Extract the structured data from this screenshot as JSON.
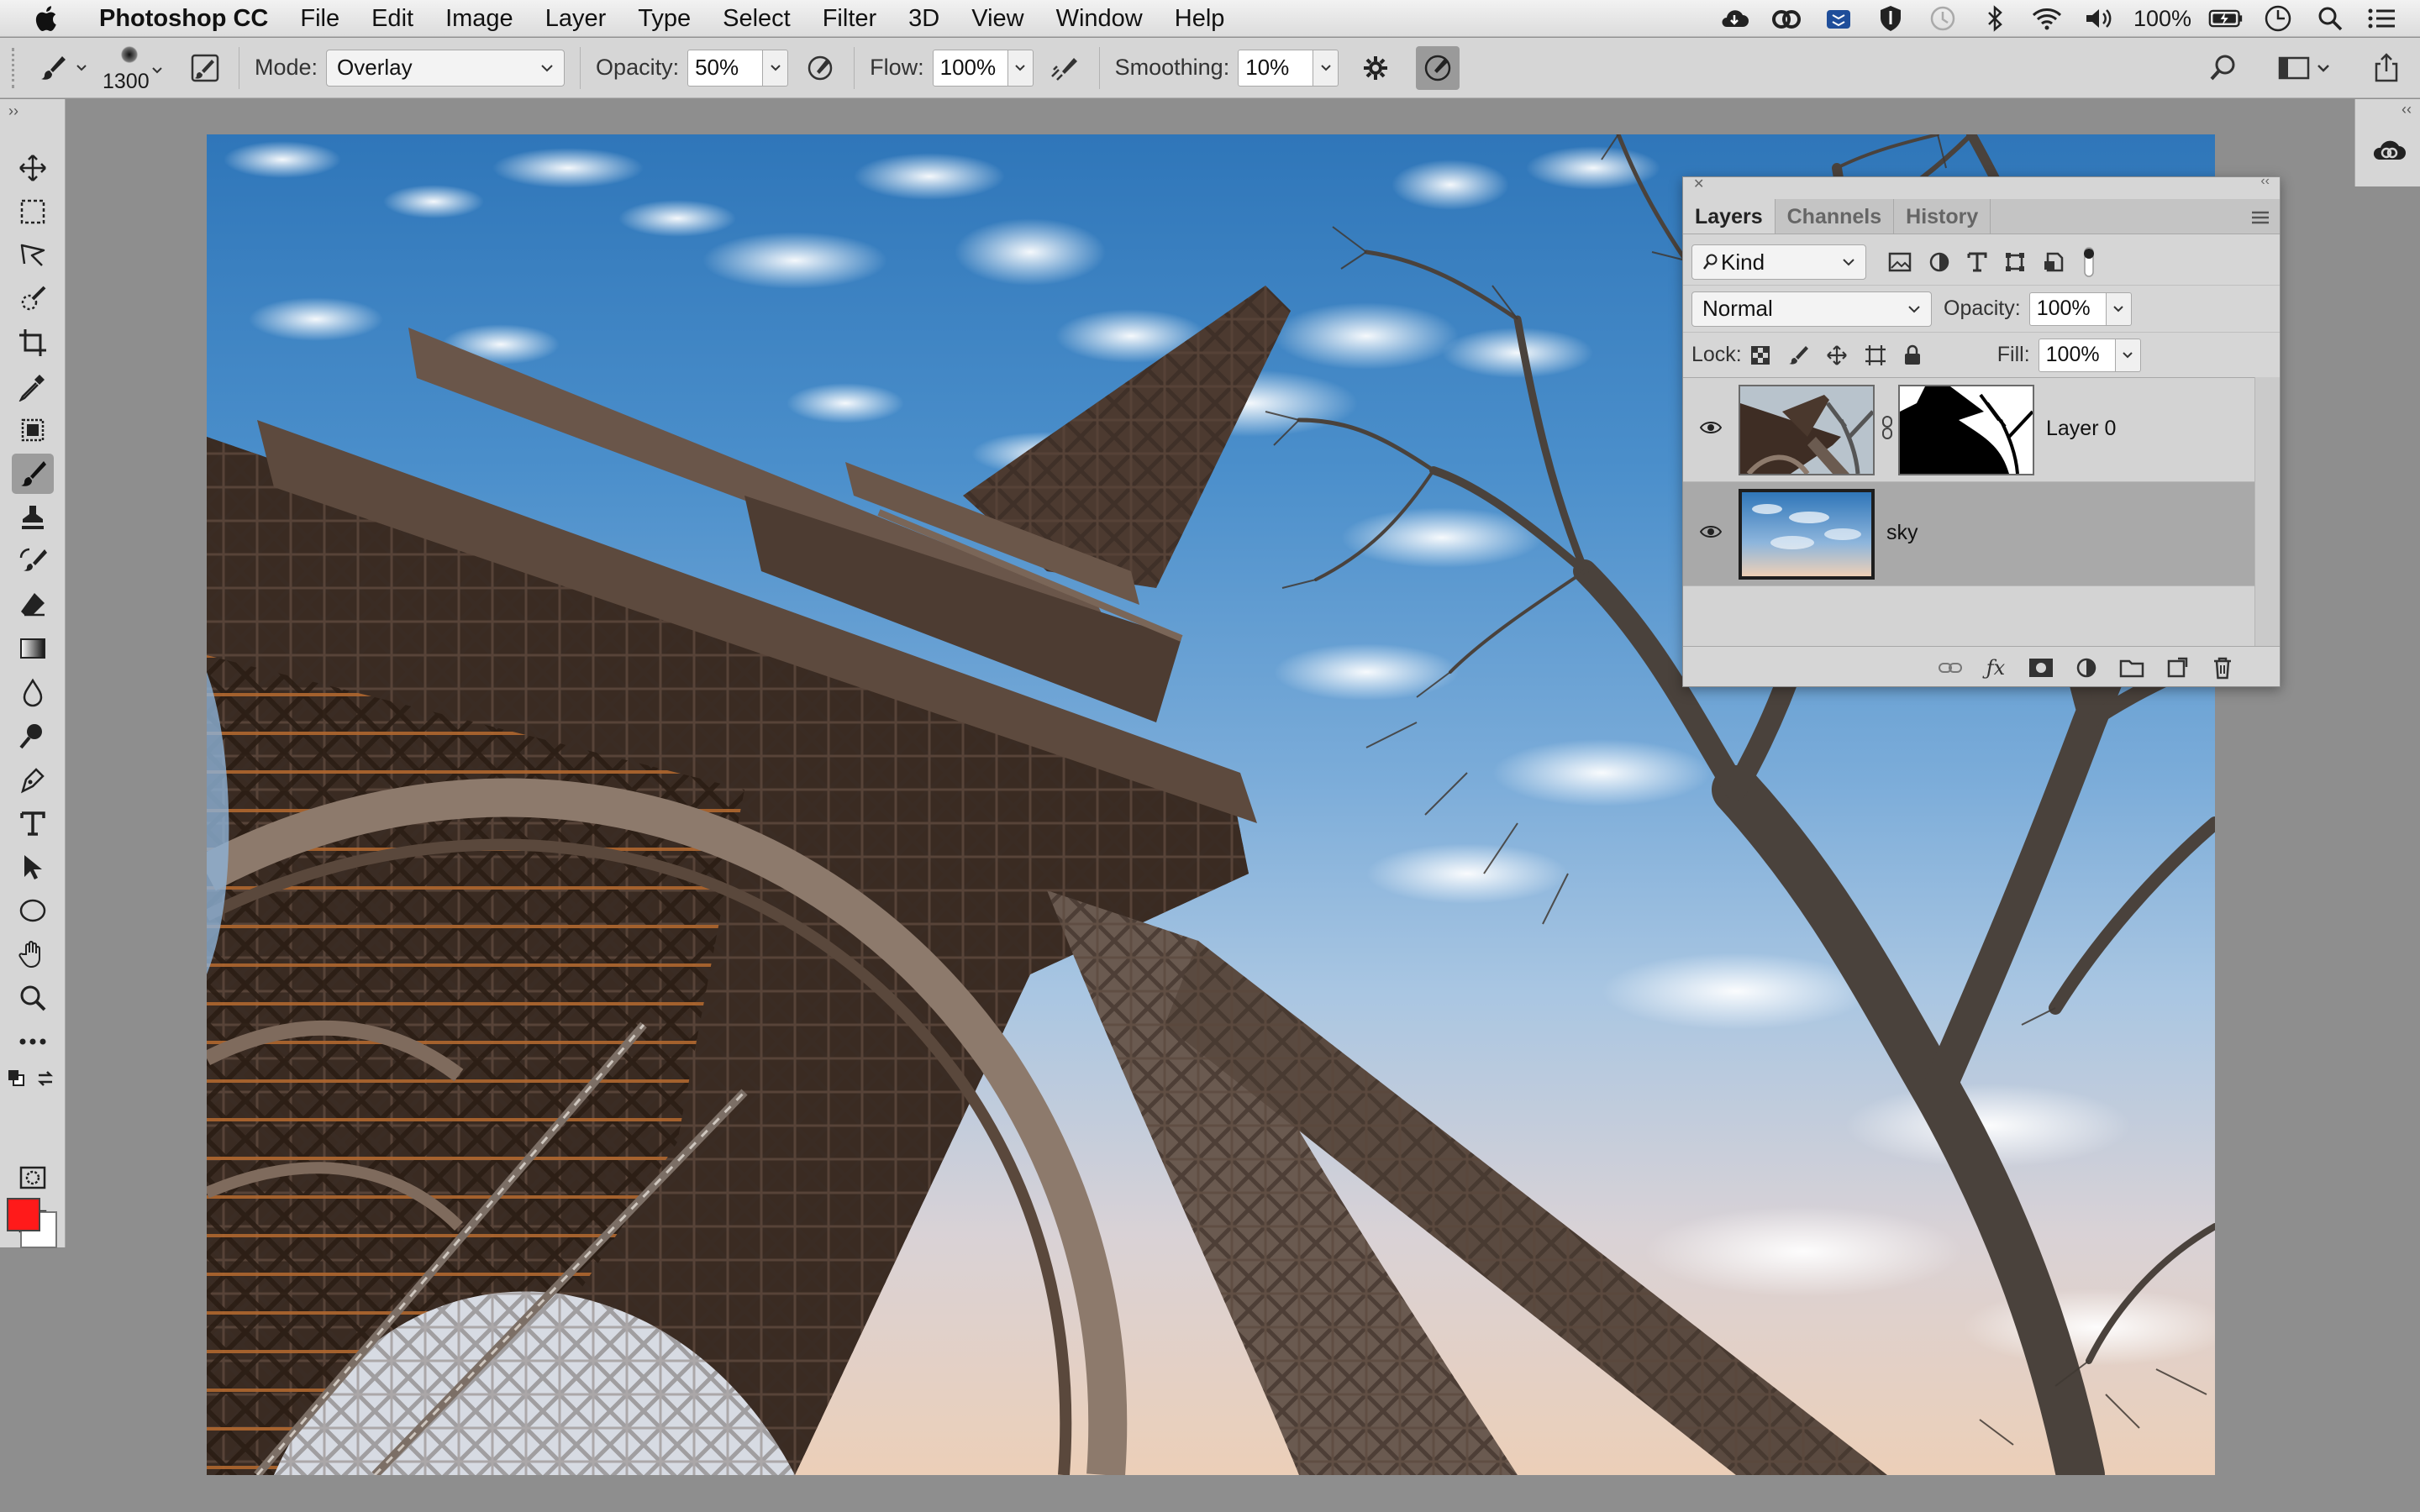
{
  "menubar": {
    "app_name": "Photoshop CC",
    "items": [
      "File",
      "Edit",
      "Image",
      "Layer",
      "Type",
      "Select",
      "Filter",
      "3D",
      "View",
      "Window",
      "Help"
    ],
    "battery": "100%"
  },
  "options": {
    "brush_size": "1300",
    "mode_label": "Mode:",
    "mode_value": "Overlay",
    "opacity_label": "Opacity:",
    "opacity_value": "50%",
    "flow_label": "Flow:",
    "flow_value": "100%",
    "smoothing_label": "Smoothing:",
    "smoothing_value": "10%"
  },
  "colors": {
    "foreground": "#ff1a1a",
    "background": "#ffffff"
  },
  "layers_panel": {
    "tabs": [
      "Layers",
      "Channels",
      "History"
    ],
    "active_tab": "Layers",
    "filter_kind": "Kind",
    "blend_mode": "Normal",
    "opacity_label": "Opacity:",
    "opacity_value": "100%",
    "lock_label": "Lock:",
    "fill_label": "Fill:",
    "fill_value": "100%",
    "layers": [
      {
        "name": "Layer 0",
        "has_mask": true,
        "visible": true,
        "selected": false
      },
      {
        "name": "sky",
        "has_mask": false,
        "visible": true,
        "selected": true
      }
    ]
  }
}
